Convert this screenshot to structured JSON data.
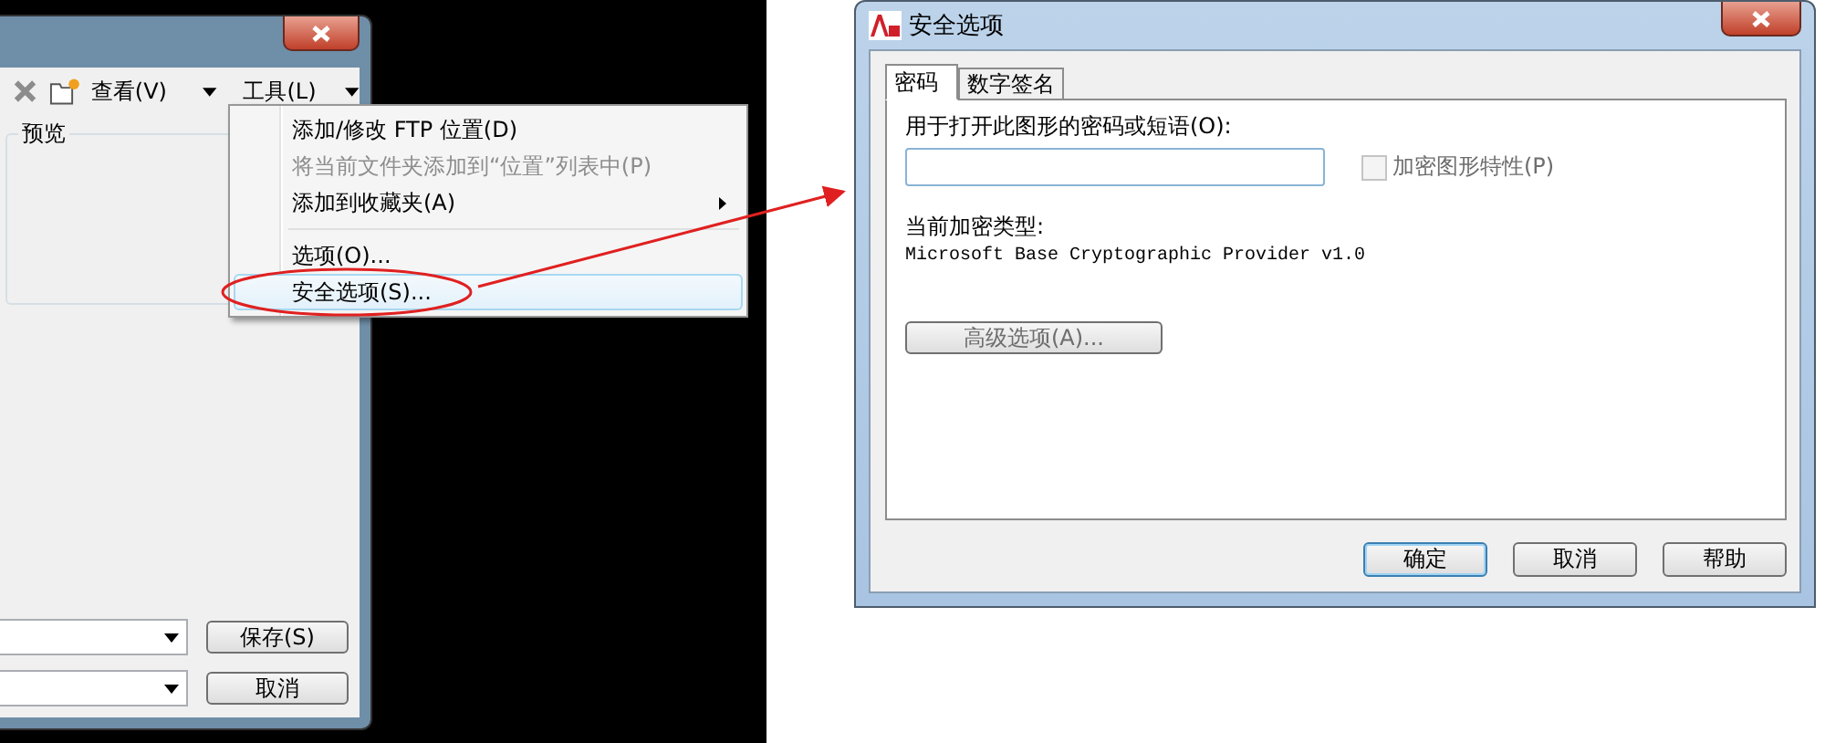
{
  "save_dialog": {
    "toolbar": [
      {
        "kind": "delete"
      },
      {
        "kind": "new-folder"
      },
      {
        "kind": "menu",
        "label": "查看(V)"
      },
      {
        "kind": "menu",
        "label": "工具(L)"
      }
    ],
    "preview": {
      "label": "预览"
    },
    "fields": [
      {
        "button": "保存(S)",
        "default": false
      },
      {
        "button": "取消",
        "default": false
      }
    ]
  },
  "tools_menu": {
    "items": [
      {
        "kind": "item",
        "label": "添加/修改 FTP 位置(D)",
        "disabled": false,
        "submenu": false,
        "selected": false
      },
      {
        "kind": "item",
        "label": "将当前文件夹添加到“位置”列表中(P)",
        "disabled": true,
        "submenu": false,
        "selected": false
      },
      {
        "kind": "item",
        "label": "添加到收藏夹(A)",
        "disabled": false,
        "submenu": true,
        "selected": false
      },
      {
        "kind": "separator"
      },
      {
        "kind": "item",
        "label": "选项(O)...",
        "disabled": false,
        "submenu": false,
        "selected": false
      },
      {
        "kind": "item",
        "label": "安全选项(S)...",
        "disabled": false,
        "submenu": false,
        "selected": true
      }
    ]
  },
  "security_dialog": {
    "title": "安全选项",
    "tabs": [
      {
        "label": "密码",
        "selected": true
      },
      {
        "label": "数字签名",
        "selected": false
      }
    ],
    "password_label": "用于打开此图形的密码或短语(O):",
    "encrypt_properties": {
      "label": "加密图形特性(P)",
      "checked": false,
      "disabled": true
    },
    "encryption_type_label": "当前加密类型:",
    "encryption_type": "Microsoft Base Cryptographic Provider v1.0",
    "advanced_button": {
      "label": "高级选项(A)...",
      "disabled": true
    },
    "buttons": [
      {
        "label": "确定",
        "default": true
      },
      {
        "label": "取消",
        "default": false
      },
      {
        "label": "帮助",
        "default": false
      }
    ]
  }
}
